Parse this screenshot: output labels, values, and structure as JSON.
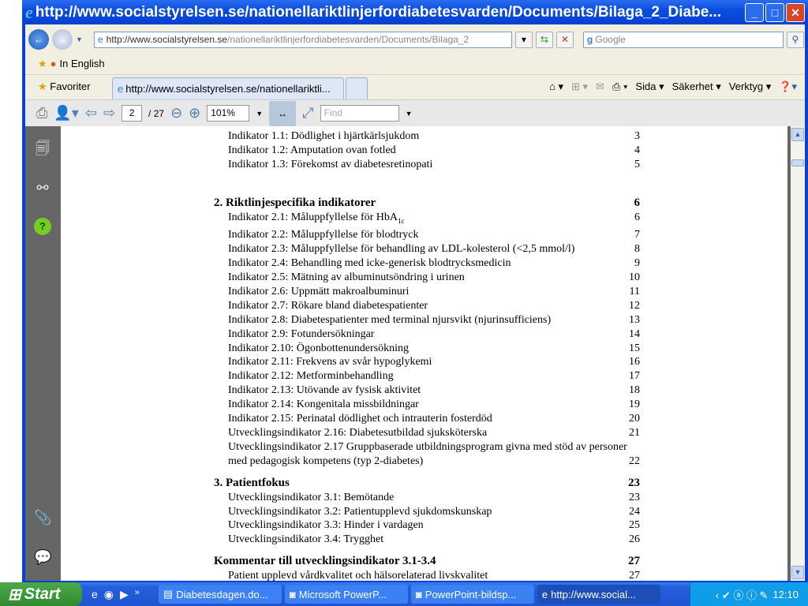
{
  "window": {
    "title": "http://www.socialstyrelsen.se/nationellariktlinjerfordiabetesvarden/Documents/Bilaga_2_Diabe..."
  },
  "address": {
    "host": "http://www.socialstyrelsen.se",
    "path": "/nationellariktlinjerfordiabetesvarden/Documents/Bilaga_2",
    "search_placeholder": "Google"
  },
  "links": {
    "in_english": "In English"
  },
  "tabs": {
    "favorites": "Favoriter",
    "active_tab": "http://www.socialstyrelsen.se/nationellariktli..."
  },
  "commandbar": {
    "page": "Sida",
    "safety": "Säkerhet",
    "tools": "Verktyg"
  },
  "pdf": {
    "current_page": "2",
    "total_pages": "/ 27",
    "zoom": "101%",
    "find_placeholder": "Find"
  },
  "toc": [
    {
      "heading": null,
      "items": [
        {
          "text": "Indikator 1.1: Dödlighet i hjärtkärlsjukdom",
          "page": "3"
        },
        {
          "text": "Indikator 1.2: Amputation ovan fotled",
          "page": "4"
        },
        {
          "text": "Indikator 1.3: Förekomst av diabetesretinopati",
          "page": "5"
        }
      ]
    },
    {
      "heading": {
        "text": "2. Riktlinjespecifika indikatorer",
        "page": "6"
      },
      "items": [
        {
          "text": "Indikator 2.1: Måluppfyllelse för HbA",
          "sub": "1c",
          "page": "6"
        },
        {
          "text": "Indikator 2.2: Måluppfyllelse för blodtryck",
          "page": "7"
        },
        {
          "text": "Indikator 2.3: Måluppfyllelse för behandling av LDL-kolesterol (<2,5 mmol/l)",
          "page": "8"
        },
        {
          "text": "Indikator 2.4: Behandling med icke-generisk blodtrycksmedicin",
          "page": "9"
        },
        {
          "text": "Indikator 2.5: Mätning av albuminutsöndring i urinen",
          "page": "10"
        },
        {
          "text": "Indikator 2.6: Uppmätt makroalbuminuri",
          "page": "11"
        },
        {
          "text": "Indikator 2.7: Rökare bland diabetespatienter",
          "page": "12"
        },
        {
          "text": "Indikator 2.8: Diabetespatienter med terminal njursvikt (njurinsufficiens)",
          "page": "13"
        },
        {
          "text": "Indikator 2.9: Fotundersökningar",
          "page": "14"
        },
        {
          "text": "Indikator 2.10: Ögonbottenundersökning",
          "page": "15"
        },
        {
          "text": "Indikator 2.11: Frekvens av svår hypoglykemi",
          "page": "16"
        },
        {
          "text": "Indikator 2.12: Metforminbehandling",
          "page": "17"
        },
        {
          "text": "Indikator 2.13: Utövande av fysisk aktivitet",
          "page": "18"
        },
        {
          "text": "Indikator 2.14: Kongenitala missbildningar",
          "page": "19"
        },
        {
          "text": "Indikator 2.15: Perinatal dödlighet och intrauterin fosterdöd",
          "page": "20"
        },
        {
          "text": "Utvecklingsindikator 2.16: Diabetesutbildad sjuksköterska",
          "page": "21"
        },
        {
          "text": "Utvecklingsindikator 2.17 Gruppbaserade utbildningsprogram givna med stöd av personer med pedagogisk kompetens (typ 2-diabetes)",
          "page": "22",
          "wrap": true
        }
      ]
    },
    {
      "heading": {
        "text": "3. Patientfokus",
        "page": "23"
      },
      "items": [
        {
          "text": "Utvecklingsindikator 3.1: Bemötande",
          "page": "23"
        },
        {
          "text": "Utvecklingsindikator 3.2: Patientupplevd sjukdomskunskap",
          "page": "24"
        },
        {
          "text": "Utvecklingsindikator 3.3: Hinder i vardagen",
          "page": "25"
        },
        {
          "text": "Utvecklingsindikator 3.4: Trygghet",
          "page": "26"
        }
      ]
    },
    {
      "heading": {
        "text": "Kommentar till utvecklingsindikator 3.1-3.4",
        "page": "27"
      },
      "items": [
        {
          "text": "Patient upplevd vårdkvalitet och hälsorelaterad livskvalitet",
          "page": "27"
        }
      ]
    }
  ],
  "taskbar": {
    "start": "Start",
    "tasks": [
      "Diabetesdagen.do...",
      "Microsoft PowerP...",
      "PowerPoint-bildsp...",
      "http://www.social..."
    ],
    "clock": "12:10"
  }
}
